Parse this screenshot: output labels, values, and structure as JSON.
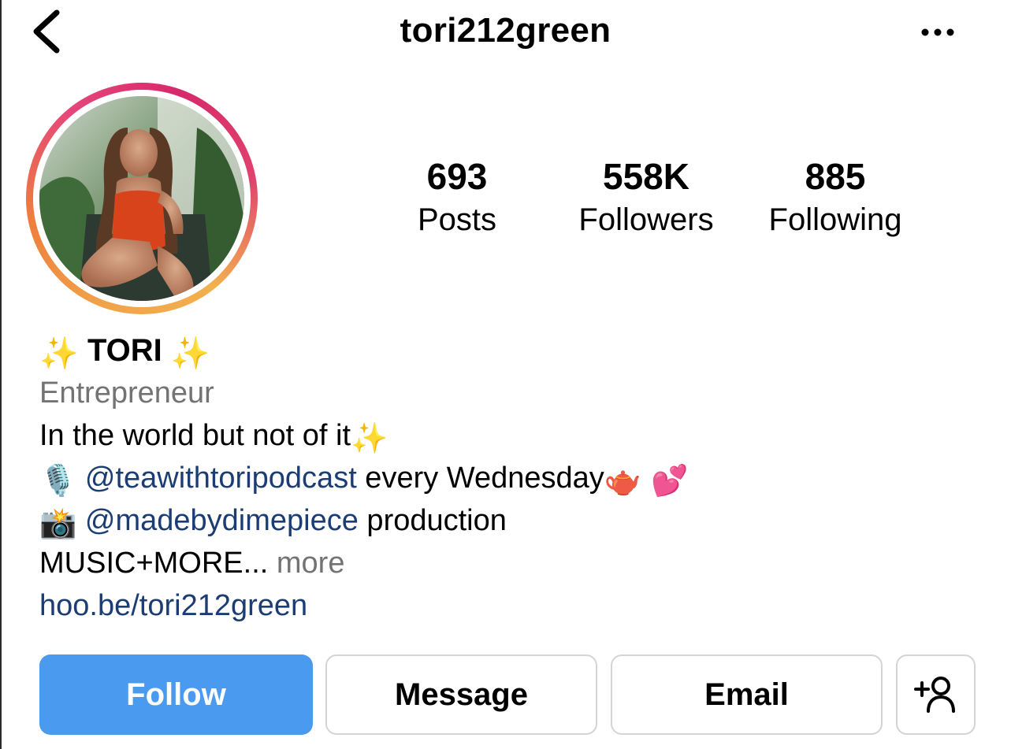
{
  "header": {
    "username": "tori212green",
    "back_icon": "chevron-left-icon",
    "more_icon": "more-horizontal-icon"
  },
  "profile": {
    "avatar_icon": "profile-photo"
  },
  "stats": {
    "posts_count": "693",
    "posts_label": "Posts",
    "followers_count": "558K",
    "followers_label": "Followers",
    "following_count": "885",
    "following_label": "Following"
  },
  "bio": {
    "name_prefix": "✨",
    "name": "TORI",
    "name_suffix": "✨",
    "category": "Entrepreneur",
    "line1_text": "In the world but not of it",
    "line1_emoji": "✨",
    "line2_emoji": "🎙️",
    "line2_mention": "@teawithtoripodcast",
    "line2_text": " every Wednesday",
    "line2_emoji_end": "🫖 💕",
    "line3_emoji": "📸",
    "line3_mention": "@madebydimepiece",
    "line3_text": " production",
    "line4_text": "MUSIC+MORE...",
    "line4_more": " more",
    "link": "hoo.be/tori212green"
  },
  "actions": {
    "follow_label": "Follow",
    "message_label": "Message",
    "email_label": "Email",
    "add_user_icon": "add-person-icon"
  },
  "colors": {
    "follow_button": "#4a9af0",
    "mention_link": "#1b3d73",
    "secondary_text": "#737373",
    "story_ring_start": "#f0a34a",
    "story_ring_end": "#d6296b"
  }
}
